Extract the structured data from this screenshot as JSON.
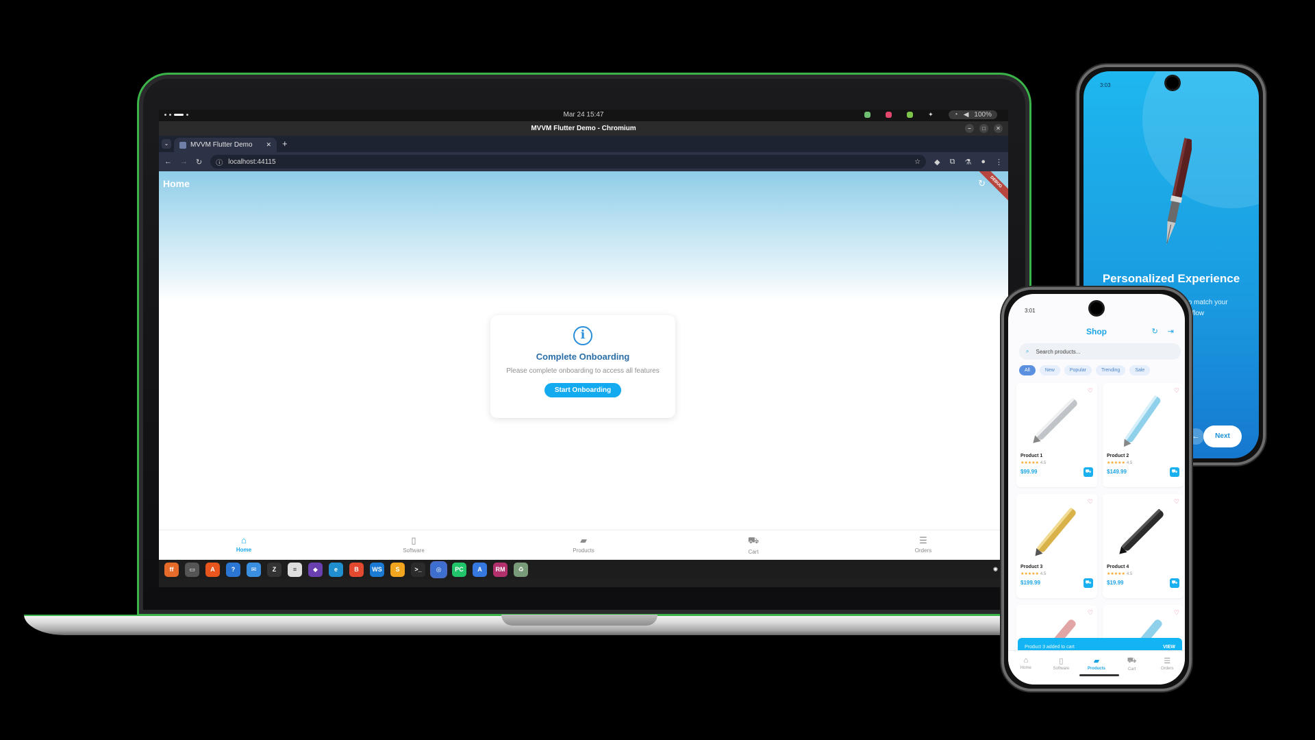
{
  "desktop": {
    "clock": "Mar 24  15:47",
    "battery": "100%",
    "window_title": "MVVM Flutter Demo - Chromium"
  },
  "browser": {
    "tab_title": "MVVM Flutter Demo",
    "url": "localhost:44115"
  },
  "web_app": {
    "title": "Home",
    "debug_banner": "DEBUG",
    "card": {
      "title": "Complete Onboarding",
      "subtitle": "Please complete onboarding to access all features",
      "button": "Start Onboarding"
    },
    "nav": [
      {
        "label": "Home",
        "icon": "home-icon"
      },
      {
        "label": "Software",
        "icon": "software-icon"
      },
      {
        "label": "Products",
        "icon": "products-icon"
      },
      {
        "label": "Cart",
        "icon": "cart-icon"
      },
      {
        "label": "Orders",
        "icon": "orders-icon"
      }
    ]
  },
  "onboarding_phone": {
    "status_time": "3:03",
    "title": "Personalized Experience",
    "subtitle_line1": "to match your",
    "subtitle_line2": "rkflow",
    "next_button": "Next"
  },
  "shop_phone": {
    "status_time": "3:01",
    "title": "Shop",
    "search_placeholder": "Search products...",
    "chips": [
      "All",
      "New",
      "Popular",
      "Trending",
      "Sale"
    ],
    "products": [
      {
        "name": "Product 1",
        "rating": "4.5",
        "price": "$99.99",
        "color": "#c0c4c8"
      },
      {
        "name": "Product 2",
        "rating": "4.5",
        "price": "$149.99",
        "color": "#8fd0ea"
      },
      {
        "name": "Product 3",
        "rating": "4.5",
        "price": "$199.99",
        "color": "#d9b24a"
      },
      {
        "name": "Product 4",
        "rating": "4.5",
        "price": "$19.99",
        "color": "#2b2b2b"
      }
    ],
    "snackbar_text": "Product 3 added to cart",
    "snackbar_action": "VIEW",
    "nav": [
      {
        "label": "Home"
      },
      {
        "label": "Software"
      },
      {
        "label": "Products"
      },
      {
        "label": "Cart"
      },
      {
        "label": "Orders"
      }
    ]
  },
  "colors": {
    "accent": "#13aaf0",
    "laptop_outline": "#3bb54a"
  }
}
